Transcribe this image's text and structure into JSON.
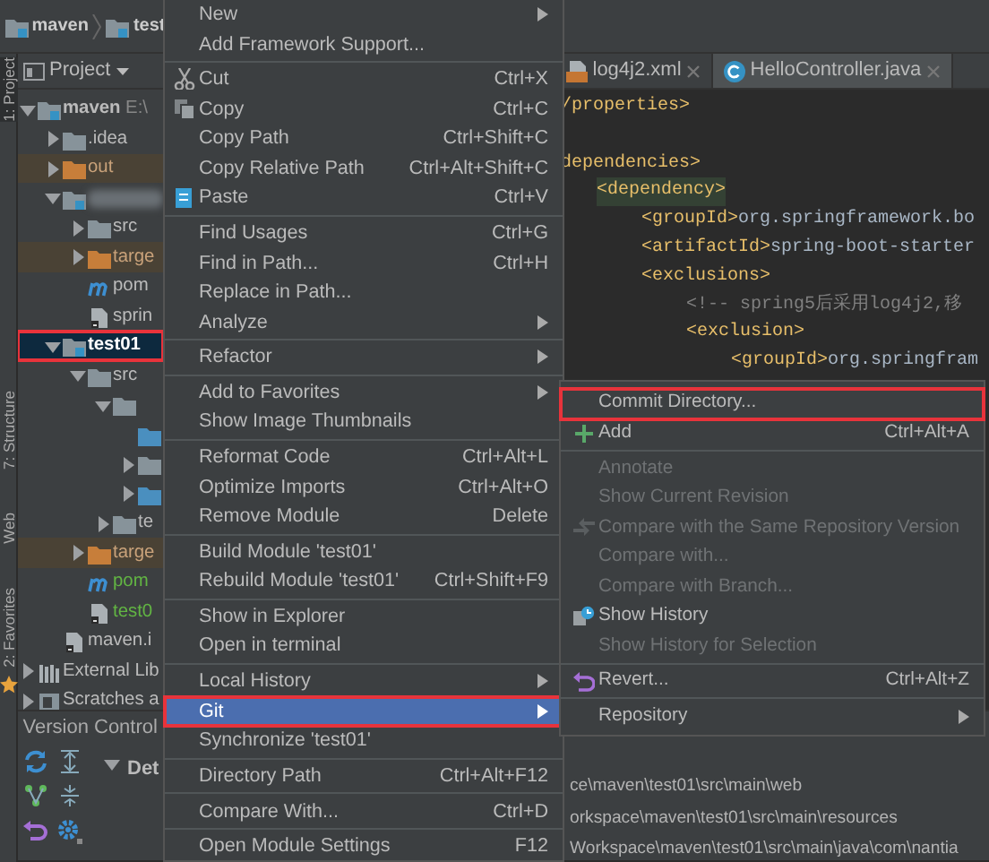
{
  "breadcrumb": [
    "maven",
    "test"
  ],
  "side_strip": [
    "1: Project",
    "7: Structure",
    "Web",
    "2: Favorites"
  ],
  "project_panel": {
    "title": "Project",
    "tree": [
      {
        "label": "maven",
        "note": "E:\\",
        "kind": "module",
        "expanded": true,
        "selected": false,
        "children": [
          {
            "label": ".idea",
            "kind": "folder",
            "expanded": false,
            "selected": false
          },
          {
            "label": "out",
            "kind": "excluded",
            "expanded": false,
            "selected": false
          },
          {
            "kind": "module",
            "redacted": true,
            "expanded": true,
            "selected": false,
            "children": [
              {
                "label": "src",
                "kind": "folder",
                "expanded": false,
                "selected": false
              },
              {
                "label": "targe",
                "kind": "excluded",
                "expanded": false,
                "selected": false
              },
              {
                "label": "pom",
                "kind": "maven",
                "selected": false
              },
              {
                "label": "sprin",
                "kind": "file",
                "selected": false
              }
            ]
          },
          {
            "label": "test01",
            "kind": "module",
            "expanded": true,
            "selected": true,
            "callout": true,
            "children": [
              {
                "label": "src",
                "kind": "folder",
                "expanded": true,
                "selected": false,
                "children": [
                  {
                    "kind": "folder",
                    "expanded": true,
                    "selected": false,
                    "children": [
                      {
                        "kind": "source",
                        "selected": false
                      },
                      {
                        "kind": "folder",
                        "expanded": false,
                        "selected": false
                      },
                      {
                        "kind": "source",
                        "expanded": false,
                        "selected": false
                      }
                    ]
                  },
                  {
                    "label": "te",
                    "kind": "folder",
                    "expanded": false,
                    "selected": false
                  }
                ]
              },
              {
                "label": "targe",
                "kind": "excluded",
                "expanded": false,
                "selected": false
              },
              {
                "label": "pom",
                "kind": "maven",
                "selected": false,
                "color": "#62b543"
              },
              {
                "label": "test0",
                "kind": "file",
                "selected": false,
                "color": "#62b543"
              }
            ]
          },
          {
            "label": "maven.i",
            "kind": "file",
            "selected": false
          }
        ]
      },
      {
        "label": "External Lib",
        "kind": "library",
        "expanded": false,
        "selected": false
      },
      {
        "label": "Scratches a",
        "kind": "scratches",
        "expanded": false,
        "selected": false
      }
    ]
  },
  "editor": {
    "tabs": [
      {
        "label": "log4j2.xml",
        "kind": "xml",
        "selected": false
      },
      {
        "label": "HelloController.java",
        "kind": "class",
        "selected": true
      }
    ],
    "code": [
      {
        "parts": [
          {
            "kind": "tag",
            "text": "/properties>"
          }
        ]
      },
      {
        "gap_before": true,
        "parts": [
          {
            "kind": "tag",
            "text": "dependencies>"
          }
        ],
        "children": [
          {
            "highlighted": true,
            "parts": [
              {
                "kind": "tag",
                "text": "<dependency>"
              }
            ],
            "children": [
              {
                "parts": [
                  {
                    "kind": "tag",
                    "text": "<groupId>"
                  },
                  {
                    "kind": "text",
                    "text": "org.springframework.bo"
                  }
                ]
              },
              {
                "parts": [
                  {
                    "kind": "tag",
                    "text": "<artifactId>"
                  },
                  {
                    "kind": "text",
                    "text": "spring-boot-starter"
                  }
                ]
              },
              {
                "parts": [
                  {
                    "kind": "tag",
                    "text": "<exclusions>"
                  }
                ],
                "children": [
                  {
                    "parts": [
                      {
                        "kind": "comment",
                        "text": "<!-- spring5后采用log4j2,移"
                      }
                    ]
                  },
                  {
                    "parts": [
                      {
                        "kind": "tag",
                        "text": "<exclusion>"
                      }
                    ],
                    "children": [
                      {
                        "parts": [
                          {
                            "kind": "tag",
                            "text": "<groupId>"
                          },
                          {
                            "kind": "text",
                            "text": "org.springfram"
                          }
                        ]
                      }
                    ]
                  }
                ]
              }
            ]
          }
        ]
      }
    ]
  },
  "context_menu": [
    {
      "kind": "item",
      "label": "New",
      "submenu": true,
      "selected": false,
      "callout": false
    },
    {
      "kind": "item",
      "label": "Add Framework Support...",
      "selected": false,
      "callout": false
    },
    {
      "kind": "separator"
    },
    {
      "kind": "item",
      "label": "Cut",
      "shortcut": "Ctrl+X",
      "selected": false,
      "callout": false
    },
    {
      "kind": "item",
      "label": "Copy",
      "shortcut": "Ctrl+C",
      "selected": false,
      "callout": false
    },
    {
      "kind": "item",
      "label": "Copy Path",
      "shortcut": "Ctrl+Shift+C",
      "selected": false,
      "callout": false
    },
    {
      "kind": "item",
      "label": "Copy Relative Path",
      "shortcut": "Ctrl+Alt+Shift+C",
      "selected": false,
      "callout": false
    },
    {
      "kind": "item",
      "label": "Paste",
      "shortcut": "Ctrl+V",
      "selected": false,
      "callout": false
    },
    {
      "kind": "separator"
    },
    {
      "kind": "item",
      "label": "Find Usages",
      "shortcut": "Ctrl+G",
      "selected": false,
      "callout": false
    },
    {
      "kind": "item",
      "label": "Find in Path...",
      "shortcut": "Ctrl+H",
      "selected": false,
      "callout": false
    },
    {
      "kind": "item",
      "label": "Replace in Path...",
      "selected": false,
      "callout": false
    },
    {
      "kind": "item",
      "label": "Analyze",
      "submenu": true,
      "selected": false,
      "callout": false
    },
    {
      "kind": "separator"
    },
    {
      "kind": "item",
      "label": "Refactor",
      "submenu": true,
      "selected": false,
      "callout": false
    },
    {
      "kind": "separator"
    },
    {
      "kind": "item",
      "label": "Add to Favorites",
      "submenu": true,
      "selected": false,
      "callout": false
    },
    {
      "kind": "item",
      "label": "Show Image Thumbnails",
      "selected": false,
      "callout": false
    },
    {
      "kind": "separator"
    },
    {
      "kind": "item",
      "label": "Reformat Code",
      "shortcut": "Ctrl+Alt+L",
      "selected": false,
      "callout": false
    },
    {
      "kind": "item",
      "label": "Optimize Imports",
      "shortcut": "Ctrl+Alt+O",
      "selected": false,
      "callout": false
    },
    {
      "kind": "item",
      "label": "Remove Module",
      "shortcut": "Delete",
      "selected": false,
      "callout": false
    },
    {
      "kind": "separator"
    },
    {
      "kind": "item",
      "label": "Build Module 'test01'",
      "selected": false,
      "callout": false
    },
    {
      "kind": "item",
      "label": "Rebuild Module 'test01'",
      "shortcut": "Ctrl+Shift+F9",
      "selected": false,
      "callout": false
    },
    {
      "kind": "separator"
    },
    {
      "kind": "item",
      "label": "Show in Explorer",
      "selected": false,
      "callout": false
    },
    {
      "kind": "item",
      "label": "Open in terminal",
      "selected": false,
      "callout": false
    },
    {
      "kind": "separator"
    },
    {
      "kind": "item",
      "label": "Local History",
      "submenu": true,
      "selected": false,
      "callout": false
    },
    {
      "kind": "item",
      "label": "Git",
      "submenu": true,
      "selected": true,
      "callout": true
    },
    {
      "kind": "item",
      "label": "Synchronize 'test01'",
      "selected": false,
      "callout": false
    },
    {
      "kind": "separator"
    },
    {
      "kind": "item",
      "label": "Directory Path",
      "shortcut": "Ctrl+Alt+F12",
      "selected": false,
      "callout": false
    },
    {
      "kind": "separator"
    },
    {
      "kind": "item",
      "label": "Compare With...",
      "shortcut": "Ctrl+D",
      "selected": false,
      "callout": false
    },
    {
      "kind": "separator"
    },
    {
      "kind": "item",
      "label": "Open Module Settings",
      "shortcut": "F12",
      "selected": false,
      "callout": false
    }
  ],
  "git_submenu": [
    {
      "kind": "item",
      "label": "Commit Directory...",
      "disabled": false,
      "selected": false,
      "callout": true
    },
    {
      "kind": "item",
      "label": "Add",
      "shortcut": "Ctrl+Alt+A",
      "disabled": false,
      "selected": false,
      "callout": false
    },
    {
      "kind": "separator"
    },
    {
      "kind": "item",
      "label": "Annotate",
      "disabled": true,
      "selected": false,
      "callout": false
    },
    {
      "kind": "item",
      "label": "Show Current Revision",
      "disabled": true,
      "selected": false,
      "callout": false
    },
    {
      "kind": "item",
      "label": "Compare with the Same Repository Version",
      "disabled": true,
      "selected": false,
      "callout": false
    },
    {
      "kind": "item",
      "label": "Compare with...",
      "disabled": true,
      "selected": false,
      "callout": false
    },
    {
      "kind": "item",
      "label": "Compare with Branch...",
      "disabled": true,
      "selected": false,
      "callout": false
    },
    {
      "kind": "item",
      "label": "Show History",
      "disabled": false,
      "selected": false,
      "callout": false
    },
    {
      "kind": "item",
      "label": "Show History for Selection",
      "disabled": true,
      "selected": false,
      "callout": false
    },
    {
      "kind": "separator"
    },
    {
      "kind": "item",
      "label": "Revert...",
      "shortcut": "Ctrl+Alt+Z",
      "disabled": false,
      "selected": false,
      "callout": false
    },
    {
      "kind": "separator"
    },
    {
      "kind": "item",
      "label": "Repository",
      "submenu": true,
      "disabled": false,
      "selected": false,
      "callout": false
    }
  ],
  "version_control": {
    "title": "Version Control",
    "details": {
      "label": "Det",
      "expanded": true
    },
    "paths": [
      "ce\\maven\\test01\\src\\main\\web",
      "orkspace\\maven\\test01\\src\\main\\resources",
      "Workspace\\maven\\test01\\src\\main\\java\\com\\nantia"
    ]
  }
}
